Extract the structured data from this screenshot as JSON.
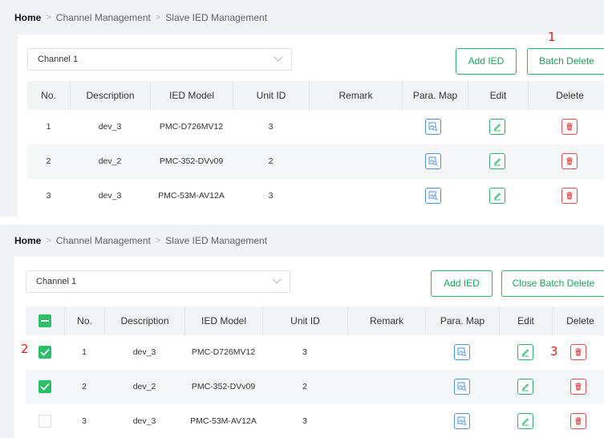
{
  "breadcrumb": {
    "home": "Home",
    "channel_management": "Channel Management",
    "slave_ied_management": "Slave IED Management"
  },
  "channel_select": {
    "value": "Channel 1"
  },
  "buttons": {
    "add_ied": "Add IED",
    "batch_delete": "Batch Delete",
    "close_batch_delete": "Close Batch Delete"
  },
  "columns": {
    "no": "No.",
    "description": "Description",
    "ied_model": "IED Model",
    "unit_id": "Unit ID",
    "remark": "Remark",
    "para_map": "Para. Map",
    "edit": "Edit",
    "delete": "Delete"
  },
  "rows": [
    {
      "no": "1",
      "description": "dev_3",
      "ied_model": "PMC-D726MV12",
      "unit_id": "3",
      "remark": ""
    },
    {
      "no": "2",
      "description": "dev_2",
      "ied_model": "PMC-352-DVv09",
      "unit_id": "2",
      "remark": ""
    },
    {
      "no": "3",
      "description": "dev_3",
      "ied_model": "PMC-53M-AV12A",
      "unit_id": "3",
      "remark": ""
    }
  ],
  "selection": {
    "header_state": "indeterminate",
    "rows_checked": [
      true,
      true,
      false
    ]
  },
  "annotations": {
    "step1": "1",
    "step2": "2",
    "step3": "3"
  },
  "colors": {
    "accent_green": "#2fb36a",
    "map_blue": "#4a90e2",
    "delete_red": "#e05050",
    "annotation_red": "#e02020"
  }
}
